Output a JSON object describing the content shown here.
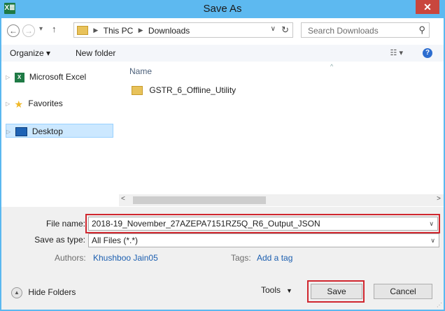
{
  "window": {
    "title": "Save As",
    "app_icon": "X≣",
    "close_glyph": "✕"
  },
  "nav": {
    "back_icon": "back-arrow-icon",
    "forward_icon": "forward-arrow-icon",
    "breadcrumb": [
      "This PC",
      "Downloads"
    ],
    "search_placeholder": "Search Downloads"
  },
  "toolbar": {
    "organize": "Organize ▾",
    "new_folder": "New folder"
  },
  "sidebar": {
    "items": [
      {
        "label": "Microsoft Excel",
        "icon": "excel-icon"
      },
      {
        "label": "Favorites",
        "icon": "star-icon"
      },
      {
        "label": "Desktop",
        "icon": "desktop-icon",
        "selected": true
      }
    ]
  },
  "files": {
    "column_name": "Name",
    "items": [
      "GSTR_6_Offline_Utility"
    ]
  },
  "form": {
    "file_name_label": "File name:",
    "file_name_value": "2018-19_November_27AZEPA7151RZ5Q_R6_Output_JSON",
    "save_type_label": "Save as type:",
    "save_type_value": "All Files (*.*)",
    "authors_label": "Authors:",
    "authors_value": "Khushboo Jain05",
    "tags_label": "Tags:",
    "tags_value": "Add a tag"
  },
  "footer": {
    "hide_folders": "Hide Folders",
    "tools": "Tools",
    "save": "Save",
    "cancel": "Cancel"
  },
  "colors": {
    "title_bar": "#5db9f0",
    "highlight": "#d0262e",
    "link": "#1c5fb0"
  }
}
